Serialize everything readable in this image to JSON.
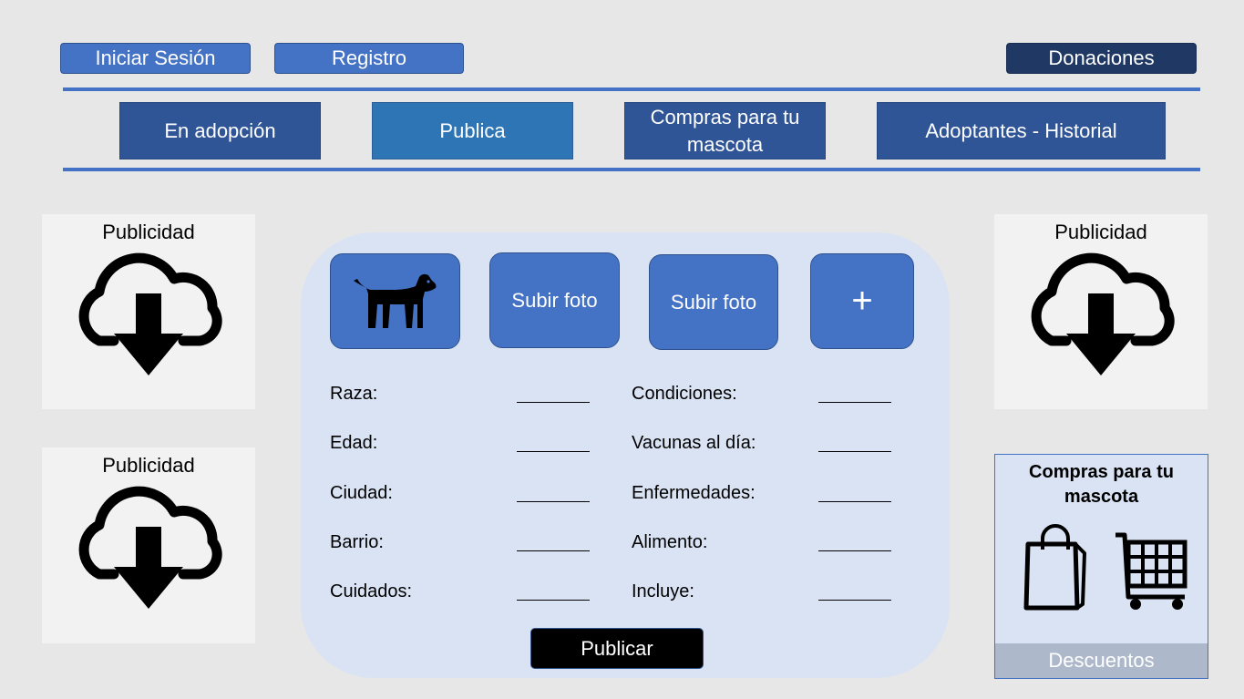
{
  "header": {
    "login_label": "Iniciar Sesión",
    "register_label": "Registro",
    "donations_label": "Donaciones"
  },
  "nav": {
    "tabs": [
      {
        "label": "En adopción",
        "active": false
      },
      {
        "label": "Publica",
        "active": true
      },
      {
        "label": "Compras para tu mascota",
        "active": false
      },
      {
        "label": "Adoptantes - Historial",
        "active": false
      }
    ]
  },
  "ads": {
    "label": "Publicidad",
    "icon": "cloud-download-icon"
  },
  "form": {
    "photo_tiles": [
      {
        "icon": "dog-icon"
      },
      {
        "label": "Subir foto"
      },
      {
        "label": "Subir foto"
      },
      {
        "label": "+"
      }
    ],
    "left_fields": [
      {
        "label": "Raza:"
      },
      {
        "label": "Edad:"
      },
      {
        "label": "Ciudad:"
      },
      {
        "label": "Barrio:"
      },
      {
        "label": "Cuidados:"
      }
    ],
    "right_fields": [
      {
        "label": "Condiciones:"
      },
      {
        "label": "Vacunas al día:"
      },
      {
        "label": "Enfermedades:"
      },
      {
        "label": "Alimento:"
      },
      {
        "label": "Incluye:"
      }
    ],
    "submit_label": "Publicar"
  },
  "shop_card": {
    "title_line1": "Compras para tu",
    "title_line2": "mascota",
    "icons": [
      "shopping-bag-icon",
      "shopping-cart-icon"
    ],
    "footer_label": "Descuentos"
  },
  "colors": {
    "accent": "#4472c4",
    "nav": "#2f5597",
    "nav_active": "#2e75b6",
    "dark": "#203864",
    "panel": "#dae3f3"
  }
}
